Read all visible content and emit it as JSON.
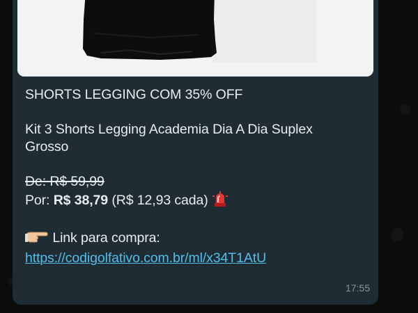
{
  "message": {
    "title": "SHORTS LEGGING COM 35% OFF",
    "description_line1": "Kit 3 Shorts Legging Academia Dia A Dia Suplex",
    "description_line2": "Grosso",
    "old_price": "De: R$ 59,99",
    "new_price_label": "Por: ",
    "new_price_value": "R$ 38,79",
    "unit_price": " (R$ 12,93 cada) ",
    "alarm_emoji": "siren-icon",
    "link_label": " Link para compra:",
    "pointing_emoji": "pointing-right-icon",
    "link_url": "https://codigolfativo.com.br/ml/x34T1AtU",
    "time": "17:55"
  },
  "media": {
    "image": "product-photo-black-shorts"
  },
  "colors": {
    "background": "#0b0d0c",
    "bubble": "#1f2c34",
    "text": "#e9edef",
    "link": "#53bdeb",
    "timestamp": "#8696a0"
  }
}
